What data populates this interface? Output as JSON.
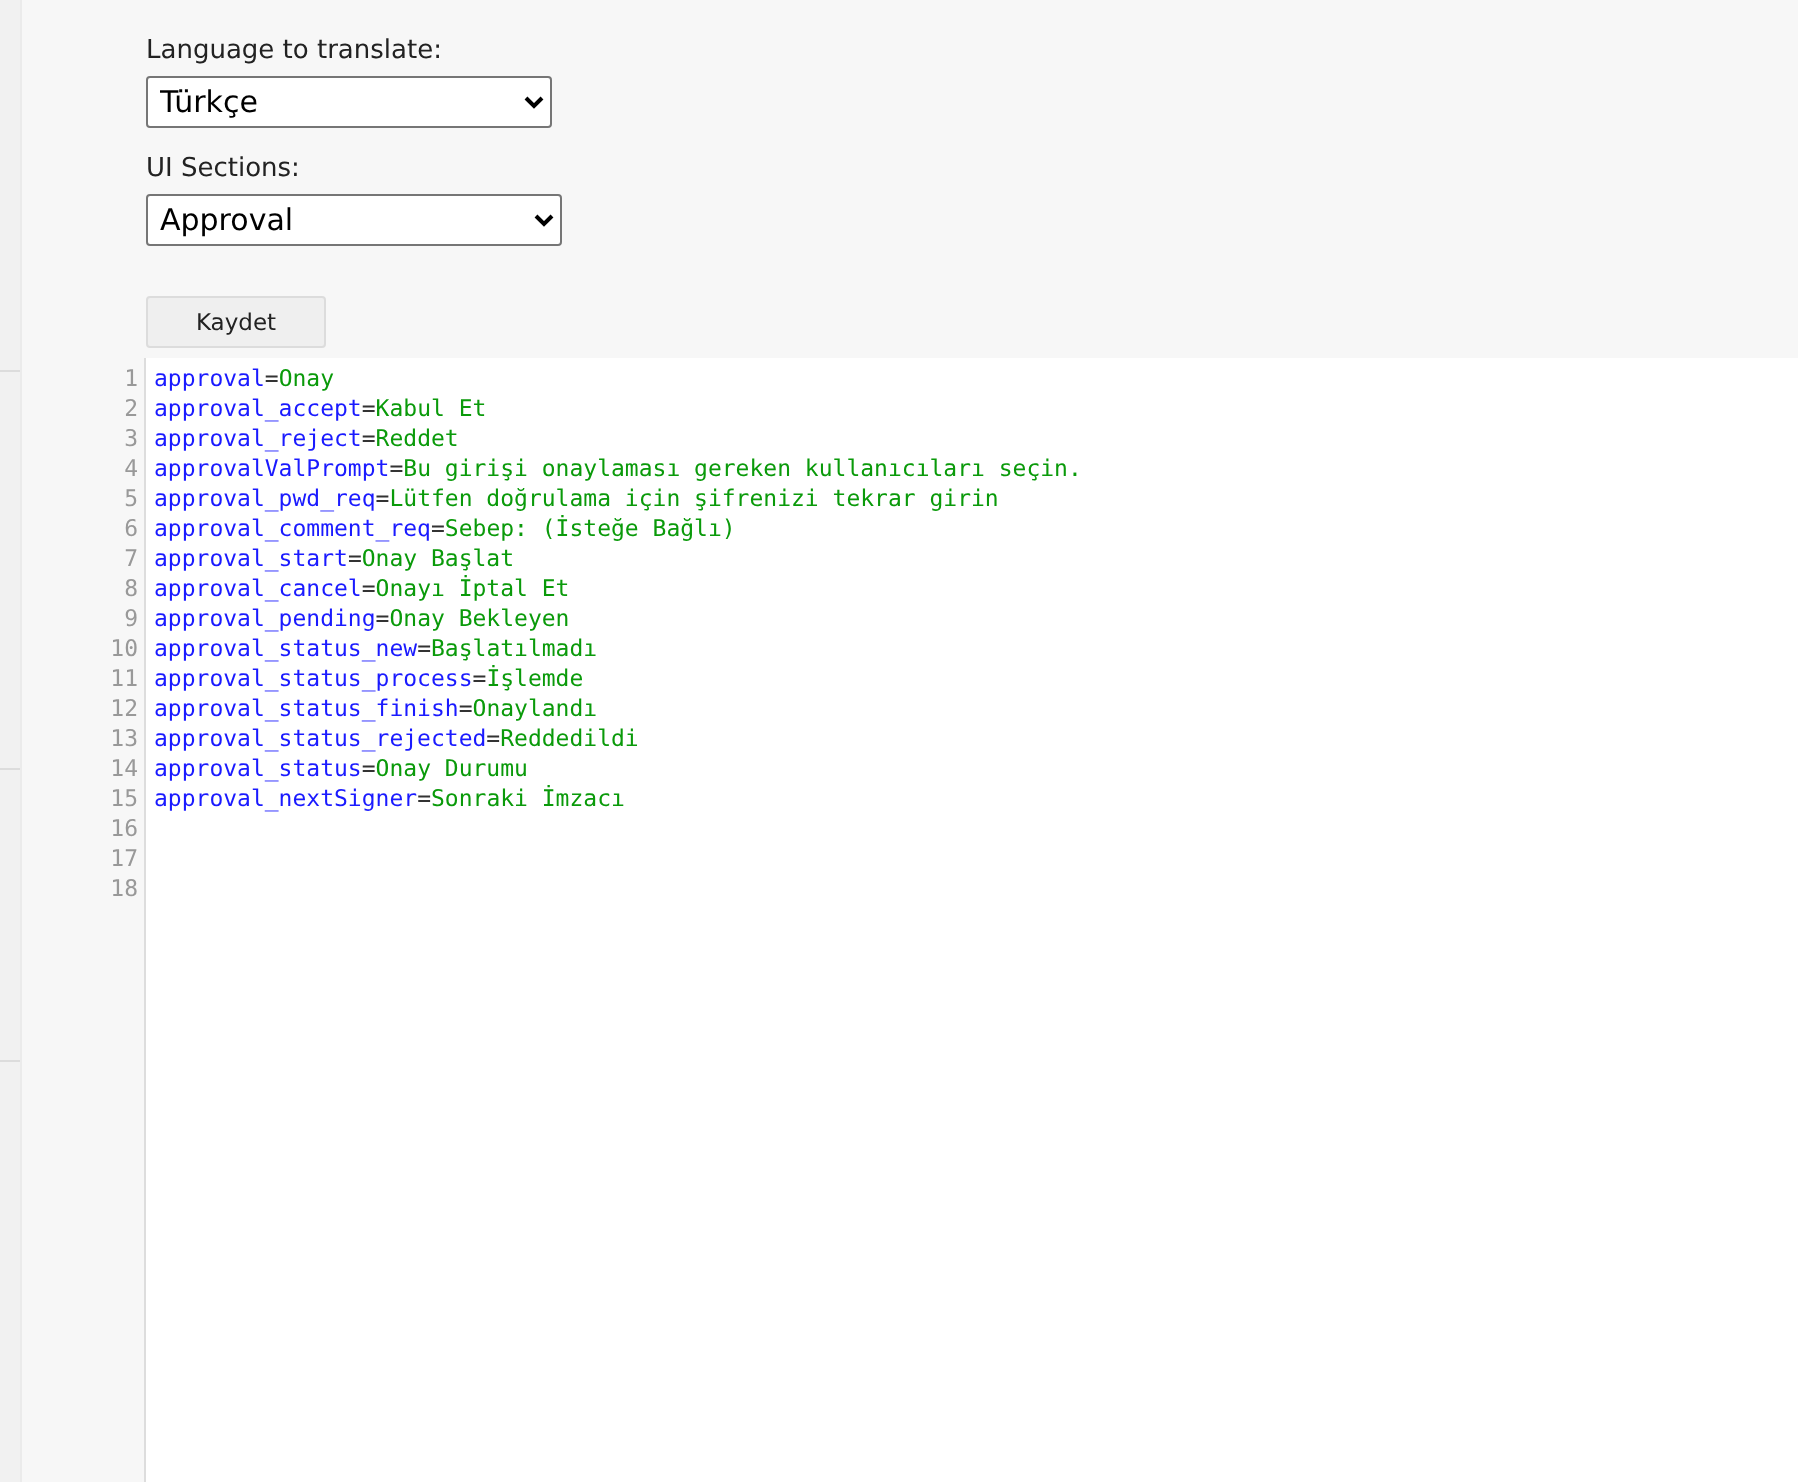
{
  "form": {
    "language_label": "Language to translate:",
    "language_value": "Türkçe",
    "sections_label": "UI Sections:",
    "sections_value": "Approval",
    "save_button": "Kaydet"
  },
  "editor": {
    "lines": [
      {
        "number": "1",
        "key": "approval",
        "sep": "=",
        "value": "Onay"
      },
      {
        "number": "2",
        "key": "approval_accept",
        "sep": "=",
        "value": "Kabul Et"
      },
      {
        "number": "3",
        "key": "approval_reject",
        "sep": "=",
        "value": "Reddet"
      },
      {
        "number": "4",
        "key": "approvalValPrompt",
        "sep": "=",
        "value": "Bu girişi onaylaması gereken kullanıcıları seçin."
      },
      {
        "number": "5",
        "key": "approval_pwd_req",
        "sep": "=",
        "value": "Lütfen doğrulama için şifrenizi tekrar girin"
      },
      {
        "number": "6",
        "key": "approval_comment_req",
        "sep": "=",
        "value": "Sebep: (İsteğe Bağlı)"
      },
      {
        "number": "7",
        "key": "approval_start",
        "sep": "=",
        "value": "Onay Başlat"
      },
      {
        "number": "8",
        "key": "approval_cancel",
        "sep": "=",
        "value": "Onayı İptal Et"
      },
      {
        "number": "9",
        "key": "approval_pending",
        "sep": "=",
        "value": "Onay Bekleyen"
      },
      {
        "number": "10",
        "key": "approval_status_new",
        "sep": "=",
        "value": "Başlatılmadı"
      },
      {
        "number": "11",
        "key": "approval_status_process",
        "sep": "=",
        "value": "İşlemde"
      },
      {
        "number": "12",
        "key": "approval_status_finish",
        "sep": "=",
        "value": "Onaylandı"
      },
      {
        "number": "13",
        "key": "approval_status_rejected",
        "sep": "=",
        "value": "Reddedildi"
      },
      {
        "number": "14",
        "key": "approval_status",
        "sep": "=",
        "value": "Onay Durumu"
      },
      {
        "number": "15",
        "key": "approval_nextSigner",
        "sep": "=",
        "value": "Sonraki İmzacı"
      },
      {
        "number": "16"
      },
      {
        "number": "17"
      },
      {
        "number": "18"
      }
    ]
  }
}
